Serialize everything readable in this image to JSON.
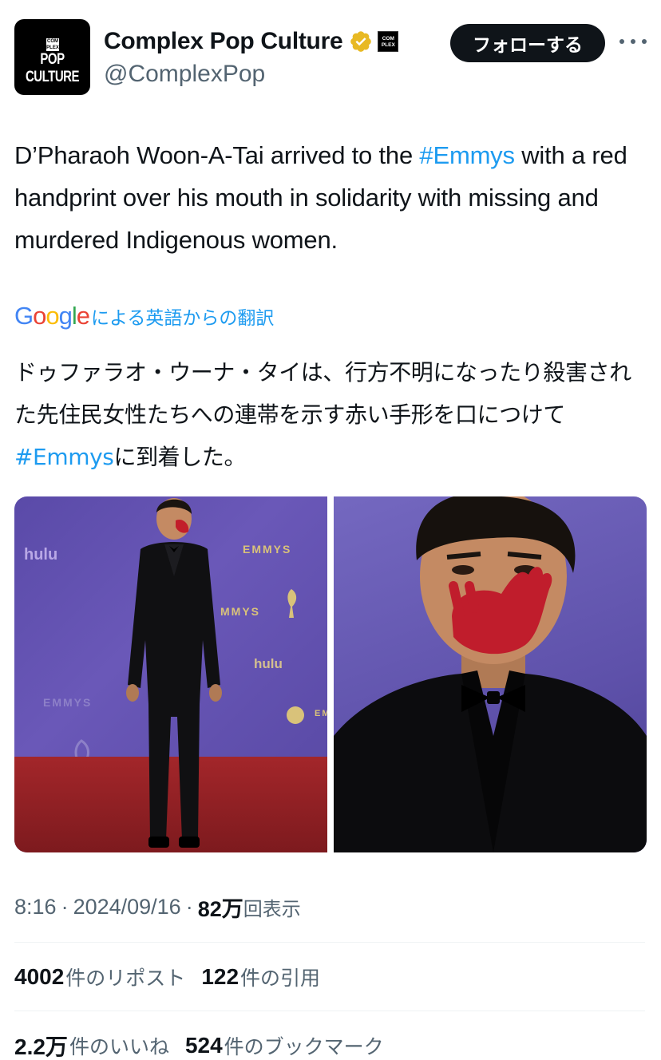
{
  "author": {
    "display_name": "Complex Pop Culture",
    "handle": "@ComplexPop",
    "avatar_text": "POP CULTURE",
    "avatar_badge": "COM PLEX",
    "affiliate_badge": "COM PLEX",
    "verified_color": "#e8b923"
  },
  "follow_button": {
    "label": "フォローする"
  },
  "tweet": {
    "text_before": "D’Pharaoh Woon-A-Tai arrived to the ",
    "hashtag": "#Emmys",
    "text_after": " with a red handprint over his mouth in solidarity with missing and murdered Indigenous women."
  },
  "translation": {
    "provider": "Google",
    "label": "による英語からの翻訳",
    "text_before": "ドゥファラオ・ウーナ・タイは、行方不明になったり殺害された先住民女性たちへの連帯を示す赤い手形を口につけて",
    "hashtag": "#Emmys",
    "text_after": "に到着した。"
  },
  "media": {
    "backdrop_words": [
      "EMMYS",
      "MMYS",
      "EMMYS",
      "EM"
    ],
    "sponsor": "hulu"
  },
  "meta": {
    "time": "8:16",
    "date": "2024/09/16",
    "views_count": "82万",
    "views_label": "回表示"
  },
  "stats": {
    "reposts_count": "4002",
    "reposts_label": "件のリポスト",
    "quotes_count": "122",
    "quotes_label": "件の引用",
    "likes_count": "2.2万",
    "likes_label": "件のいいね",
    "bookmarks_count": "524",
    "bookmarks_label": "件のブックマーク"
  },
  "colors": {
    "accent": "#1d9bf0",
    "text": "#0f1419",
    "secondary": "#536471",
    "divider": "#eff3f4"
  }
}
